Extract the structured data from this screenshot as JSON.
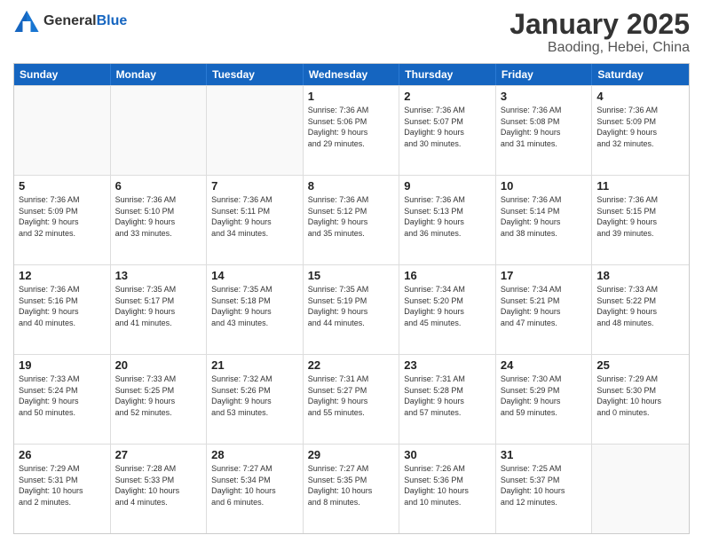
{
  "logo": {
    "general": "General",
    "blue": "Blue"
  },
  "title": {
    "month": "January 2025",
    "location": "Baoding, Hebei, China"
  },
  "weekdays": [
    "Sunday",
    "Monday",
    "Tuesday",
    "Wednesday",
    "Thursday",
    "Friday",
    "Saturday"
  ],
  "weeks": [
    [
      {
        "day": "",
        "lines": []
      },
      {
        "day": "",
        "lines": []
      },
      {
        "day": "",
        "lines": []
      },
      {
        "day": "1",
        "lines": [
          "Sunrise: 7:36 AM",
          "Sunset: 5:06 PM",
          "Daylight: 9 hours",
          "and 29 minutes."
        ]
      },
      {
        "day": "2",
        "lines": [
          "Sunrise: 7:36 AM",
          "Sunset: 5:07 PM",
          "Daylight: 9 hours",
          "and 30 minutes."
        ]
      },
      {
        "day": "3",
        "lines": [
          "Sunrise: 7:36 AM",
          "Sunset: 5:08 PM",
          "Daylight: 9 hours",
          "and 31 minutes."
        ]
      },
      {
        "day": "4",
        "lines": [
          "Sunrise: 7:36 AM",
          "Sunset: 5:09 PM",
          "Daylight: 9 hours",
          "and 32 minutes."
        ]
      }
    ],
    [
      {
        "day": "5",
        "lines": [
          "Sunrise: 7:36 AM",
          "Sunset: 5:09 PM",
          "Daylight: 9 hours",
          "and 32 minutes."
        ]
      },
      {
        "day": "6",
        "lines": [
          "Sunrise: 7:36 AM",
          "Sunset: 5:10 PM",
          "Daylight: 9 hours",
          "and 33 minutes."
        ]
      },
      {
        "day": "7",
        "lines": [
          "Sunrise: 7:36 AM",
          "Sunset: 5:11 PM",
          "Daylight: 9 hours",
          "and 34 minutes."
        ]
      },
      {
        "day": "8",
        "lines": [
          "Sunrise: 7:36 AM",
          "Sunset: 5:12 PM",
          "Daylight: 9 hours",
          "and 35 minutes."
        ]
      },
      {
        "day": "9",
        "lines": [
          "Sunrise: 7:36 AM",
          "Sunset: 5:13 PM",
          "Daylight: 9 hours",
          "and 36 minutes."
        ]
      },
      {
        "day": "10",
        "lines": [
          "Sunrise: 7:36 AM",
          "Sunset: 5:14 PM",
          "Daylight: 9 hours",
          "and 38 minutes."
        ]
      },
      {
        "day": "11",
        "lines": [
          "Sunrise: 7:36 AM",
          "Sunset: 5:15 PM",
          "Daylight: 9 hours",
          "and 39 minutes."
        ]
      }
    ],
    [
      {
        "day": "12",
        "lines": [
          "Sunrise: 7:36 AM",
          "Sunset: 5:16 PM",
          "Daylight: 9 hours",
          "and 40 minutes."
        ]
      },
      {
        "day": "13",
        "lines": [
          "Sunrise: 7:35 AM",
          "Sunset: 5:17 PM",
          "Daylight: 9 hours",
          "and 41 minutes."
        ]
      },
      {
        "day": "14",
        "lines": [
          "Sunrise: 7:35 AM",
          "Sunset: 5:18 PM",
          "Daylight: 9 hours",
          "and 43 minutes."
        ]
      },
      {
        "day": "15",
        "lines": [
          "Sunrise: 7:35 AM",
          "Sunset: 5:19 PM",
          "Daylight: 9 hours",
          "and 44 minutes."
        ]
      },
      {
        "day": "16",
        "lines": [
          "Sunrise: 7:34 AM",
          "Sunset: 5:20 PM",
          "Daylight: 9 hours",
          "and 45 minutes."
        ]
      },
      {
        "day": "17",
        "lines": [
          "Sunrise: 7:34 AM",
          "Sunset: 5:21 PM",
          "Daylight: 9 hours",
          "and 47 minutes."
        ]
      },
      {
        "day": "18",
        "lines": [
          "Sunrise: 7:33 AM",
          "Sunset: 5:22 PM",
          "Daylight: 9 hours",
          "and 48 minutes."
        ]
      }
    ],
    [
      {
        "day": "19",
        "lines": [
          "Sunrise: 7:33 AM",
          "Sunset: 5:24 PM",
          "Daylight: 9 hours",
          "and 50 minutes."
        ]
      },
      {
        "day": "20",
        "lines": [
          "Sunrise: 7:33 AM",
          "Sunset: 5:25 PM",
          "Daylight: 9 hours",
          "and 52 minutes."
        ]
      },
      {
        "day": "21",
        "lines": [
          "Sunrise: 7:32 AM",
          "Sunset: 5:26 PM",
          "Daylight: 9 hours",
          "and 53 minutes."
        ]
      },
      {
        "day": "22",
        "lines": [
          "Sunrise: 7:31 AM",
          "Sunset: 5:27 PM",
          "Daylight: 9 hours",
          "and 55 minutes."
        ]
      },
      {
        "day": "23",
        "lines": [
          "Sunrise: 7:31 AM",
          "Sunset: 5:28 PM",
          "Daylight: 9 hours",
          "and 57 minutes."
        ]
      },
      {
        "day": "24",
        "lines": [
          "Sunrise: 7:30 AM",
          "Sunset: 5:29 PM",
          "Daylight: 9 hours",
          "and 59 minutes."
        ]
      },
      {
        "day": "25",
        "lines": [
          "Sunrise: 7:29 AM",
          "Sunset: 5:30 PM",
          "Daylight: 10 hours",
          "and 0 minutes."
        ]
      }
    ],
    [
      {
        "day": "26",
        "lines": [
          "Sunrise: 7:29 AM",
          "Sunset: 5:31 PM",
          "Daylight: 10 hours",
          "and 2 minutes."
        ]
      },
      {
        "day": "27",
        "lines": [
          "Sunrise: 7:28 AM",
          "Sunset: 5:33 PM",
          "Daylight: 10 hours",
          "and 4 minutes."
        ]
      },
      {
        "day": "28",
        "lines": [
          "Sunrise: 7:27 AM",
          "Sunset: 5:34 PM",
          "Daylight: 10 hours",
          "and 6 minutes."
        ]
      },
      {
        "day": "29",
        "lines": [
          "Sunrise: 7:27 AM",
          "Sunset: 5:35 PM",
          "Daylight: 10 hours",
          "and 8 minutes."
        ]
      },
      {
        "day": "30",
        "lines": [
          "Sunrise: 7:26 AM",
          "Sunset: 5:36 PM",
          "Daylight: 10 hours",
          "and 10 minutes."
        ]
      },
      {
        "day": "31",
        "lines": [
          "Sunrise: 7:25 AM",
          "Sunset: 5:37 PM",
          "Daylight: 10 hours",
          "and 12 minutes."
        ]
      },
      {
        "day": "",
        "lines": []
      }
    ]
  ]
}
